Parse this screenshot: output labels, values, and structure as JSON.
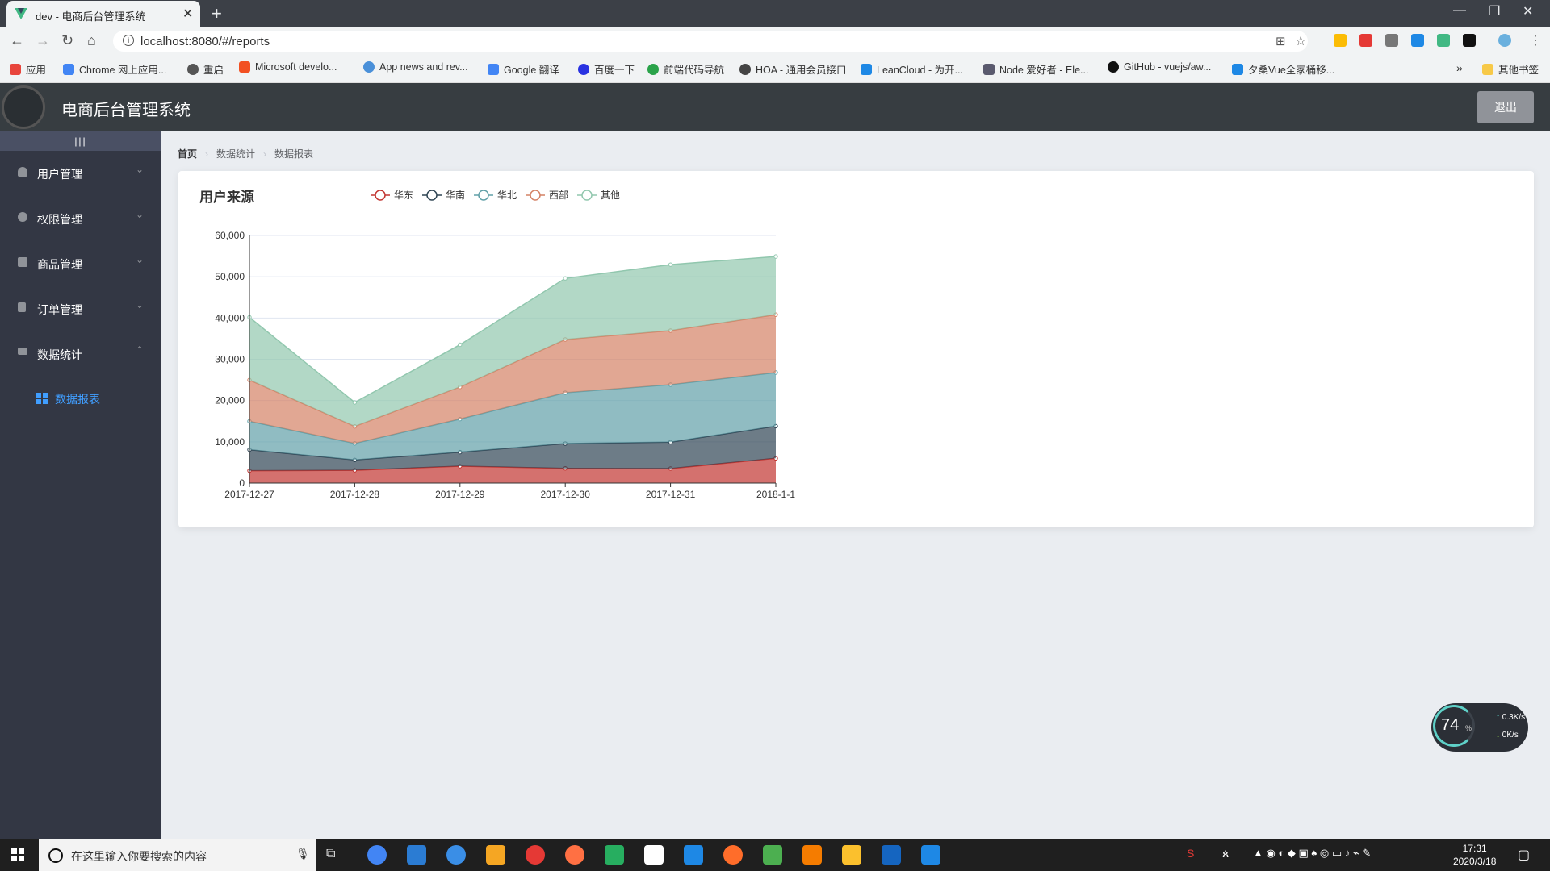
{
  "browser": {
    "tab_title": "dev - 电商后台管理系统",
    "new_tab": "+",
    "url": "localhost:8080/#/reports",
    "bookmarks": [
      {
        "label": "应用",
        "color": "#e8453c"
      },
      {
        "label": "Chrome 网上应用...",
        "color": "#4285f4"
      },
      {
        "label": "重启",
        "color": "#555555"
      },
      {
        "label": "Microsoft develo...",
        "color": "#f25022"
      },
      {
        "label": "App news and rev...",
        "color": "#4a90d9"
      },
      {
        "label": "Google 翻译",
        "color": "#4285f4"
      },
      {
        "label": "百度一下",
        "color": "#2932e1"
      },
      {
        "label": "前端代码导航",
        "color": "#2aa34a"
      },
      {
        "label": "HOA - 通用会员接口",
        "color": "#444444"
      },
      {
        "label": "LeanCloud - 为开...",
        "color": "#1e88e5"
      },
      {
        "label": "Node 爱好者 - Ele...",
        "color": "#5a5a6e"
      },
      {
        "label": "GitHub - vuejs/aw...",
        "color": "#111111"
      },
      {
        "label": "夕桑Vue全家桶移...",
        "color": "#1e88e5"
      }
    ],
    "bookmarks_more": "»",
    "other_bookmarks": "其他书签"
  },
  "header": {
    "title": "电商后台管理系统",
    "logout_label": "退出"
  },
  "sidebar": {
    "toggle_label": "|||",
    "items": [
      {
        "label": "用户管理",
        "caret": "⌄"
      },
      {
        "label": "权限管理",
        "caret": "⌄"
      },
      {
        "label": "商品管理",
        "caret": "⌄"
      },
      {
        "label": "订单管理",
        "caret": "⌄"
      },
      {
        "label": "数据统计",
        "caret": "⌃"
      }
    ],
    "active_sub": "数据报表"
  },
  "breadcrumb": [
    "首页",
    "数据统计",
    "数据报表"
  ],
  "chart_data": {
    "type": "area",
    "stacked": true,
    "title": "用户来源",
    "categories": [
      "2017-12-27",
      "2017-12-28",
      "2017-12-29",
      "2017-12-30",
      "2017-12-31",
      "2018-1-1"
    ],
    "ylim": [
      0,
      60000
    ],
    "yticks": [
      "0",
      "10,000",
      "20,000",
      "30,000",
      "40,000",
      "50,000",
      "60,000"
    ],
    "grid": true,
    "legend_position": "top",
    "series": [
      {
        "name": "华东",
        "color": "#c23531",
        "values": [
          2999,
          3111,
          4100,
          3565,
          3528,
          6000
        ]
      },
      {
        "name": "华南",
        "color": "#2f4554",
        "values": [
          5090,
          2500,
          3400,
          6000,
          6400,
          7800
        ]
      },
      {
        "name": "华北",
        "color": "#61a0a8",
        "values": [
          6888,
          4000,
          8010,
          12321,
          13928,
          12984
        ]
      },
      {
        "name": "西部",
        "color": "#d48265",
        "values": [
          9991,
          4130,
          7777,
          12903,
          13098,
          14028
        ]
      },
      {
        "name": "其他",
        "color": "#91c7ae",
        "values": [
          15212,
          5800,
          10241,
          14821,
          15982,
          14091
        ]
      }
    ]
  },
  "widget": {
    "percent": "74",
    "pct_sign": "%",
    "up": "0.3K/s",
    "down": "0K/s"
  },
  "taskbar": {
    "search_placeholder": "在这里输入你要搜索的内容",
    "time": "17:31",
    "date": "2020/3/18"
  }
}
